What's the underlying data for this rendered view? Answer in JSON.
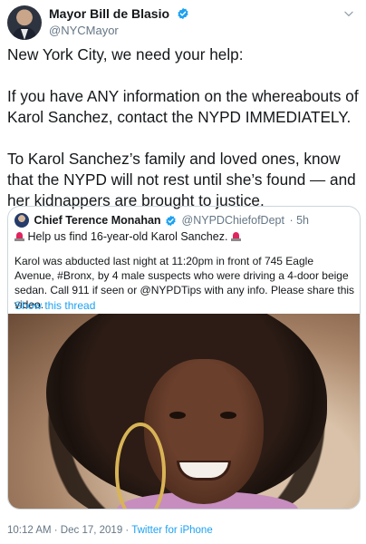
{
  "tweet": {
    "author": {
      "display_name": "Mayor Bill de Blasio",
      "handle": "@NYCMayor"
    },
    "body": [
      "New York City, we need your help:",
      "If you have ANY information on the whereabouts of Karol Sanchez, contact the NYPD IMMEDIATELY.",
      "To Karol Sanchez’s family and loved ones, know that the NYPD will not rest until she’s found — and her kidnappers are brought to justice."
    ],
    "timestamp": "10:12 AM · Dec 17, 2019 · ",
    "source": "Twitter for iPhone"
  },
  "quote": {
    "author": {
      "display_name": "Chief Terence Monahan",
      "handle": "@NYPDChiefofDept",
      "age": "· 5h"
    },
    "headline": "Help us find 16-year-old Karol Sanchez.",
    "text": "Karol was abducted last night at 11:20pm in front of 745 Eagle Avenue, #Bronx, by 4 male suspects who were driving a 4-door beige sedan. Call 911 if seen or @NYPDTips with any info. Please share this video.",
    "show_thread": "Show this thread"
  },
  "colors": {
    "accent": "#1da1f2",
    "text": "#14171a",
    "muted": "#657786",
    "border": "#ccd6dd",
    "siren": "#e0245e"
  },
  "icons": [
    "verified-badge-icon",
    "chevron-down-icon",
    "police-siren-icon"
  ]
}
